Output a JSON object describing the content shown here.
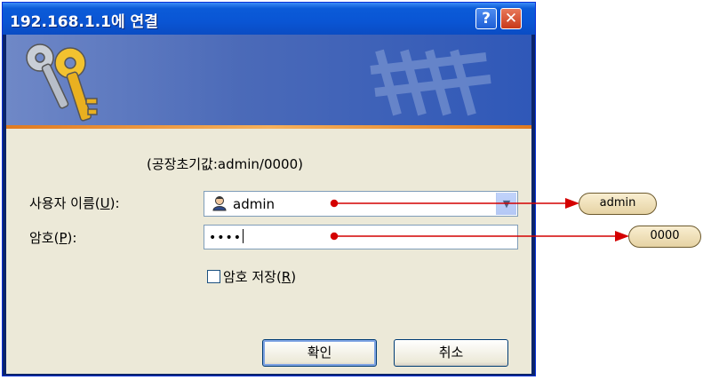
{
  "dialog": {
    "title": "192.168.1.1에 연결",
    "help_glyph": "?",
    "close_glyph": "✕",
    "hint": "(공장초기값:admin/0000)",
    "username": {
      "label_prefix": "사용자 이름(",
      "accesskey": "U",
      "label_suffix": "):",
      "value": "admin"
    },
    "password": {
      "label_prefix": "암호(",
      "accesskey": "P",
      "label_suffix": "):",
      "masked_value": "••••"
    },
    "remember": {
      "label_prefix": "암호 저장(",
      "accesskey": "R",
      "label_suffix": ")",
      "checked": false
    },
    "ok_label": "확인",
    "cancel_label": "취소"
  },
  "callouts": {
    "username_value": "admin",
    "password_value": "0000"
  },
  "colors": {
    "titlebar": "#0a55d4",
    "dialog_bg": "#ece9d8",
    "arrow": "#d40000",
    "pill_fill": "#efe0b9"
  },
  "icons": {
    "banner": "keys-icon",
    "user": "user-account-icon"
  }
}
